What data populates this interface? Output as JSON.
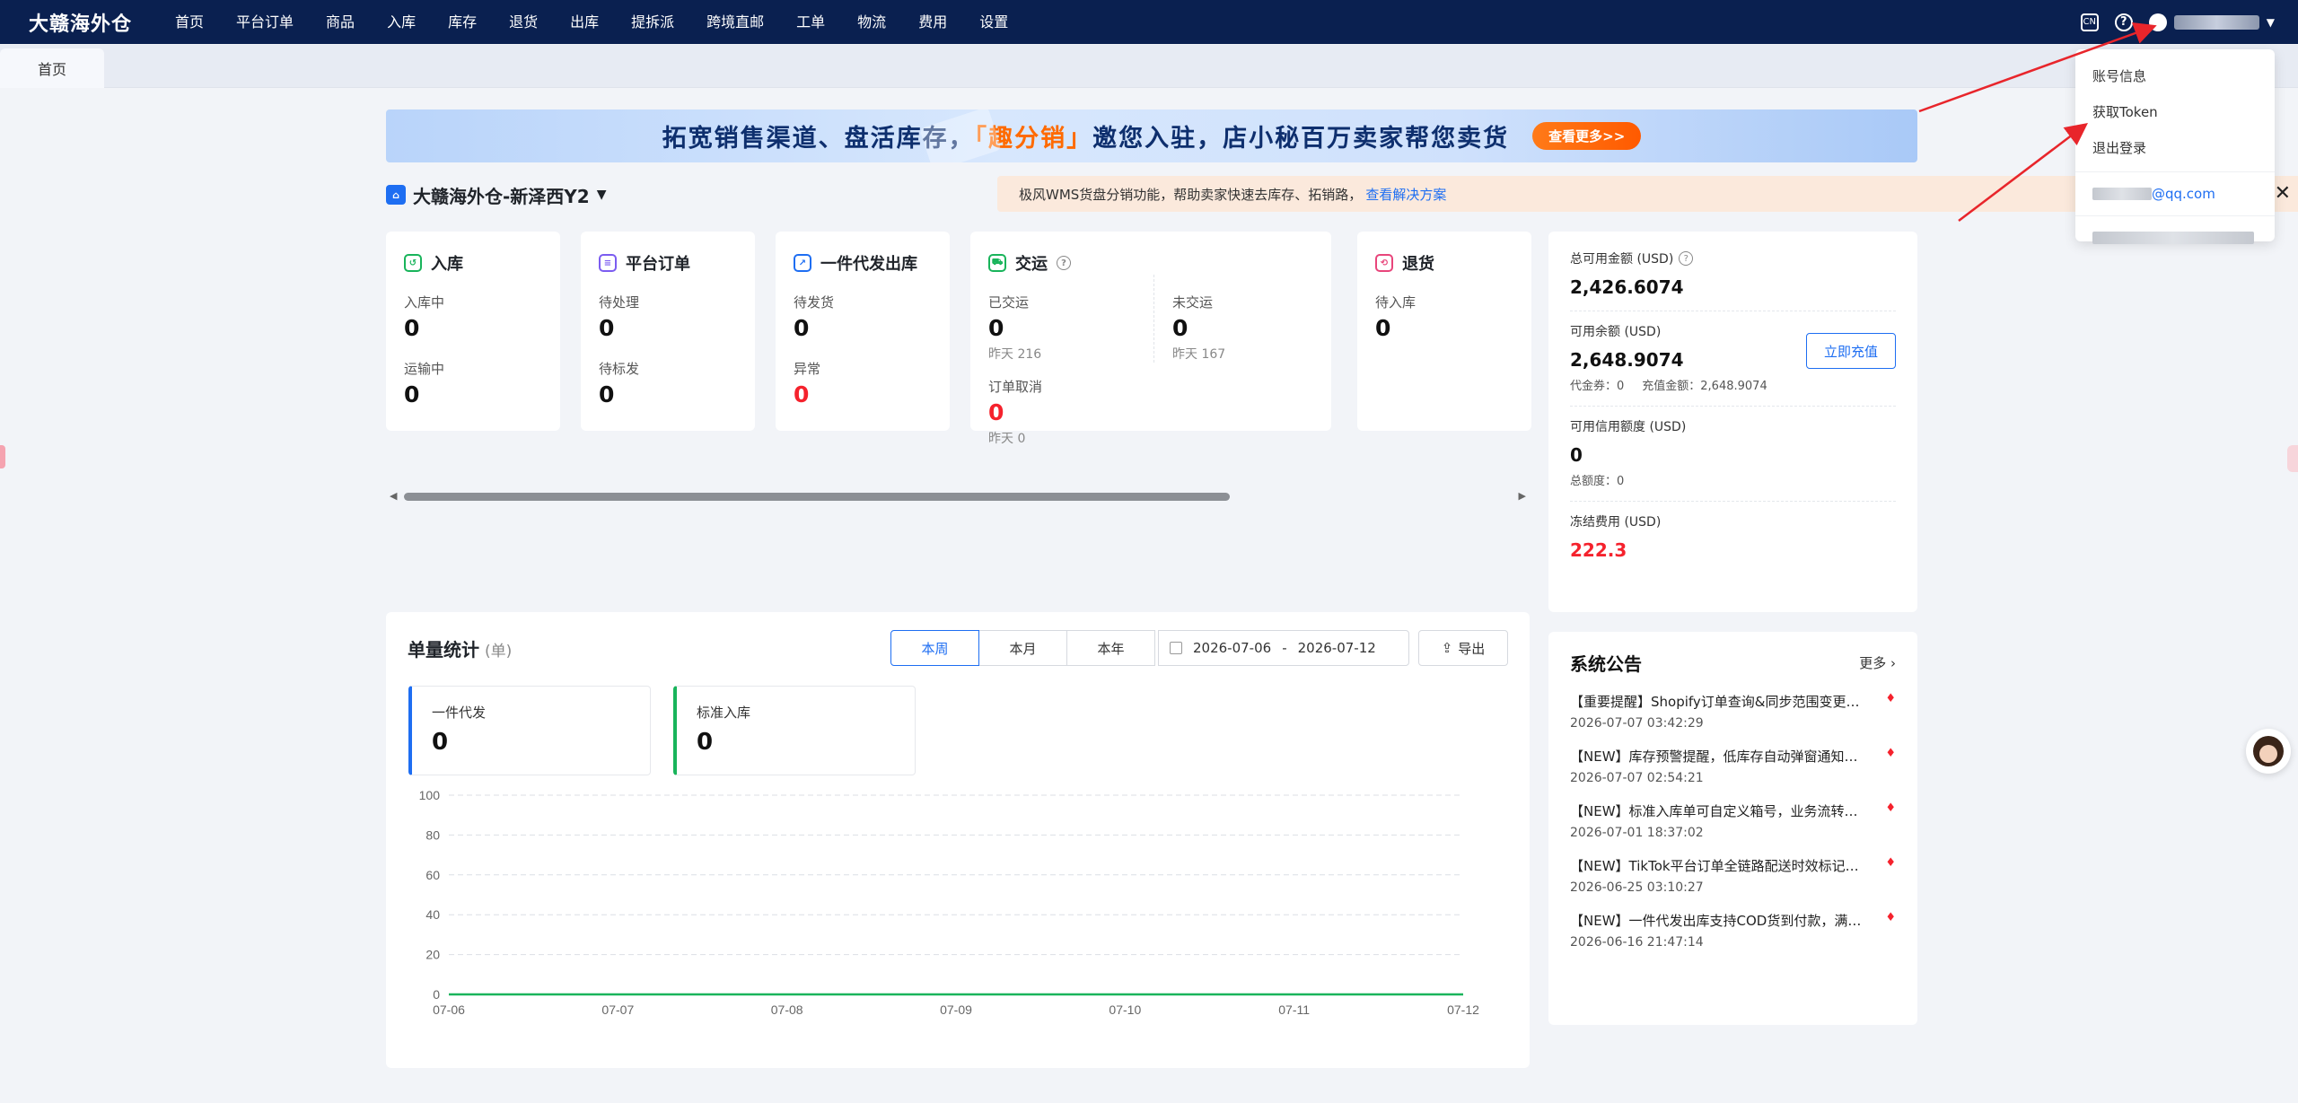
{
  "brand": "大赣海外仓",
  "nav": [
    "首页",
    "平台订单",
    "商品",
    "入库",
    "库存",
    "退货",
    "出库",
    "提拆派",
    "跨境直邮",
    "工单",
    "物流",
    "费用",
    "设置"
  ],
  "top_icons": {
    "lang_icon": "CN",
    "help": "?"
  },
  "tabs": [
    {
      "label": "首页"
    }
  ],
  "banner": {
    "text_before": "拓宽销售渠道、盘活库存，",
    "highlight": "「趣分销」",
    "text_after": "邀您入驻，店小秘百万卖家帮您卖货",
    "button": "查看更多>>"
  },
  "warehouse": {
    "name": "大赣海外仓-新泽西Y2"
  },
  "notice": {
    "text": "极风WMS货盘分销功能，帮助卖家快速去库存、拓销路，",
    "link": "查看解决方案"
  },
  "cards": {
    "inbound": {
      "title": "入库",
      "l1": "入库中",
      "v1": "0",
      "l2": "运输中",
      "v2": "0"
    },
    "orders": {
      "title": "平台订单",
      "l1": "待处理",
      "v1": "0",
      "l2": "待标发",
      "v2": "0"
    },
    "dropship": {
      "title": "一件代发出库",
      "l1": "待发货",
      "v1": "0",
      "l2": "异常",
      "v2": "0"
    },
    "handover": {
      "title": "交运",
      "l1": "已交运",
      "v1": "0",
      "s1": "昨天 216",
      "l2": "未交运",
      "v2": "0",
      "s2": "昨天 167",
      "l3": "订单取消",
      "v3": "0",
      "s3": "昨天 0"
    },
    "returns": {
      "title": "退货",
      "l1": "待入库",
      "v1": "0"
    }
  },
  "stats": {
    "title": "单量统计",
    "unit": "(单)",
    "periods": [
      "本周",
      "本月",
      "本年"
    ],
    "date_from": "2026-07-06",
    "date_sep": "-",
    "date_to": "2026-07-12",
    "export": "导出",
    "kpis": [
      {
        "label": "一件代发",
        "value": "0"
      },
      {
        "label": "标准入库",
        "value": "0"
      }
    ]
  },
  "chart_data": {
    "type": "line",
    "categories": [
      "07-06",
      "07-07",
      "07-08",
      "07-09",
      "07-10",
      "07-11",
      "07-12"
    ],
    "series": [
      {
        "values": [
          0,
          0,
          0,
          0,
          0,
          0,
          0
        ]
      }
    ],
    "yticks": [
      "0",
      "20",
      "40",
      "60",
      "80",
      "100"
    ],
    "ylim": [
      0,
      100
    ],
    "grid": true,
    "line_color": "#19b45b"
  },
  "balance": {
    "total_label": "总可用金额 (USD)",
    "total_value": "2,426.6074",
    "avail_label": "可用余额 (USD)",
    "avail_value": "2,648.9074",
    "voucher": "代金券：0",
    "recharge_amt": "充值金额：2,648.9074",
    "recharge_btn": "立即充值",
    "credit_label": "可用信用额度 (USD)",
    "credit_value": "0",
    "credit_total": "总额度：0",
    "frozen_label": "冻结费用 (USD)",
    "frozen_value": "222.3"
  },
  "announcements": {
    "title": "系统公告",
    "more": "更多",
    "items": [
      {
        "text": "【重要提醒】Shopify订单查询&同步范围变更…",
        "time": "2026-07-07 03:42:29"
      },
      {
        "text": "【NEW】库存预警提醒，低库存自动弹窗通知…",
        "time": "2026-07-07 02:54:21"
      },
      {
        "text": "【NEW】标准入库单可自定义箱号，业务流转…",
        "time": "2026-07-01 18:37:02"
      },
      {
        "text": "【NEW】TikTok平台订单全链路配送时效标记…",
        "time": "2026-06-25 03:10:27"
      },
      {
        "text": "【NEW】一件代发出库支持COD货到付款，满…",
        "time": "2026-06-16 21:47:14"
      }
    ]
  },
  "user_menu": {
    "items": [
      "账号信息",
      "获取Token",
      "退出登录"
    ],
    "email_suffix": "@qq.com"
  },
  "colors": {
    "nav_bg": "#0a2050",
    "primary": "#1e6ef2",
    "danger": "#f5222d",
    "success": "#19b45b"
  }
}
